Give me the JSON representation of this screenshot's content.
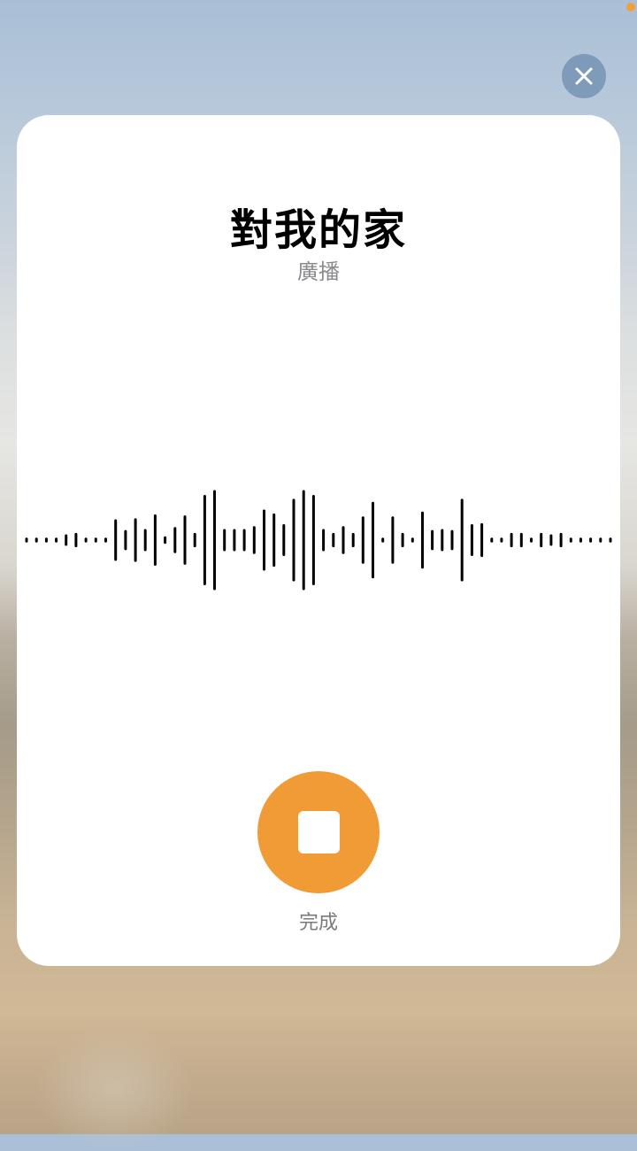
{
  "header": {
    "title": "對我的家",
    "subtitle": "廣播"
  },
  "controls": {
    "close_icon": "close-x-icon",
    "stop_icon": "stop-square-icon",
    "done_label": "完成"
  },
  "colors": {
    "accent": "#f09b36",
    "close_button": "#7b97b8",
    "privacy_indicator": "#f0a03e",
    "waveform": "#000000"
  },
  "waveform": {
    "levels": [
      0.02,
      0.02,
      0.02,
      0.02,
      0.09,
      0.12,
      0.02,
      0.02,
      0.02,
      0.4,
      0.18,
      0.42,
      0.2,
      0.5,
      0.05,
      0.24,
      0.48,
      0.12,
      0.9,
      1.0,
      0.2,
      0.2,
      0.2,
      0.26,
      0.6,
      0.52,
      0.3,
      0.82,
      1.0,
      0.9,
      0.2,
      0.12,
      0.26,
      0.12,
      0.46,
      0.76,
      0.02,
      0.46,
      0.12,
      0.02,
      0.56,
      0.18,
      0.2,
      0.18,
      0.82,
      0.3,
      0.32,
      0.02,
      0.02,
      0.12,
      0.12,
      0.02,
      0.12,
      0.09,
      0.12,
      0.02,
      0.02,
      0.02,
      0.02,
      0.02
    ]
  }
}
